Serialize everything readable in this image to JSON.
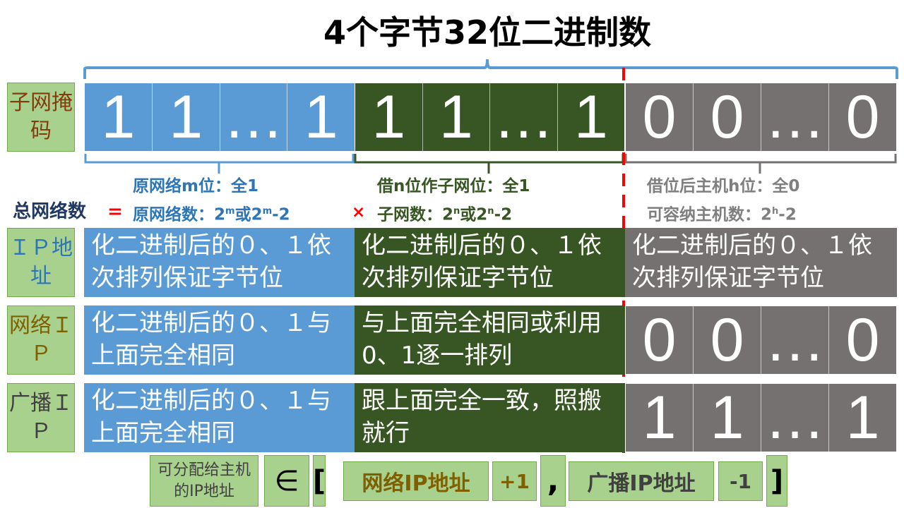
{
  "title": "4个字节32位二进制数",
  "rows": {
    "mask": {
      "label": "子网掩码",
      "net": [
        "1",
        "1",
        "…",
        "1"
      ],
      "sub": [
        "1",
        "1",
        "…",
        "1"
      ],
      "host": [
        "0",
        "0",
        "…",
        "0"
      ]
    },
    "ip": {
      "label": "ＩＰ地址",
      "net": "化二进制后的０、１依次排列保证字节位",
      "sub": "化二进制后的０、１依次排列保证字节位",
      "host": "化二进制后的０、１依次排列保证字节位"
    },
    "network": {
      "label": "网络ＩＰ",
      "net": "化二进制后的０、１与上面完全相同",
      "sub": "与上面完全相同或利用0、1逐一排列",
      "host": [
        "0",
        "0",
        "…",
        "0"
      ]
    },
    "broadcast": {
      "label": "广播ＩＰ",
      "net": "化二进制后的０、１与上面完全相同",
      "sub": "跟上面完全一致，照搬就行",
      "host": [
        "1",
        "1",
        "…",
        "1"
      ]
    }
  },
  "notes": {
    "net_line1": "原网络m位：全1",
    "net_line2_pre": "原网络数：2",
    "net_sup1": "m",
    "net_mid": "或2",
    "net_sup2": "m",
    "net_post": "-2",
    "sub_line1": "借n位作子网位：全1",
    "sub_line2_pre": "子网数：2",
    "sub_sup1": "n",
    "sub_mid": "或2",
    "sub_sup2": "n",
    "sub_post": "-2",
    "host_line1": "借位后主机h位：全0",
    "host_line2_pre": "可容纳主机数：2",
    "host_sup": "h",
    "host_post": "-2",
    "total": "总网络数",
    "eq": "=",
    "times": "×"
  },
  "formula": {
    "lhs": "可分配给主机的IP地址",
    "in": "∈",
    "lbr": "[",
    "a": "网络IP地址",
    "plus": "+1",
    "comma": ",",
    "b": "广播IP地址",
    "minus": "-1",
    "rbr": "]"
  },
  "colors": {
    "blue": "#5b9bd5",
    "green": "#375623",
    "gray": "#767171",
    "red": "#ff0000"
  }
}
